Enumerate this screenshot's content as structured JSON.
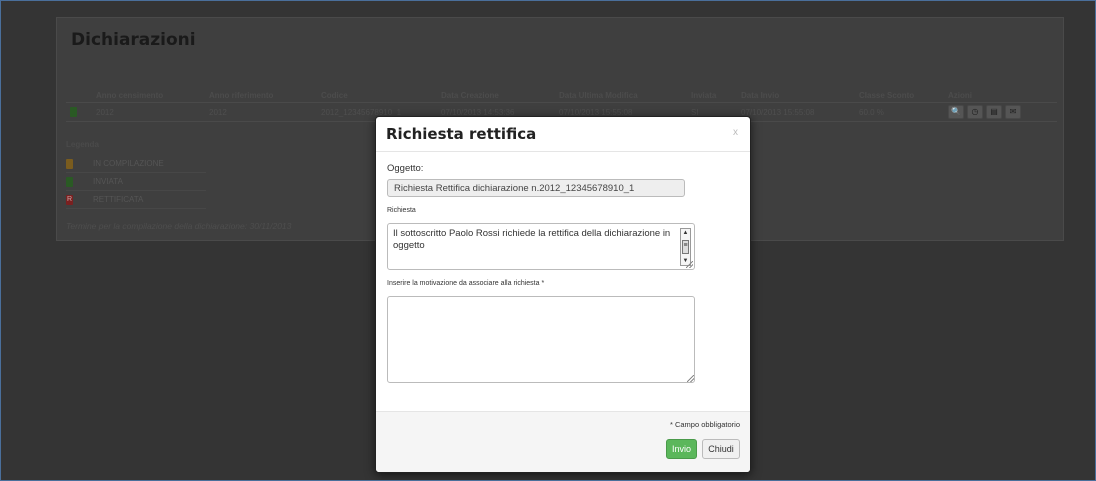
{
  "page": {
    "title": "Dichiarazioni"
  },
  "table": {
    "headers": [
      "",
      "Anno censimento",
      "Anno riferimento",
      "Codice",
      "Data Creazione",
      "Data Ultima Modifica",
      "Inviata",
      "Data Invio",
      "Classe Sconto",
      "Azioni"
    ],
    "row": {
      "status": "green",
      "anno_censimento": "2012",
      "anno_riferimento": "2012",
      "codice": "2012_12345678910_1",
      "data_creazione": "07/10/2013 14:53:36",
      "data_ultima_modifica": "07/10/2013 15:55:08",
      "inviata": "SI",
      "data_invio": "07/10/2013 15:55:08",
      "classe_sconto": "60.0 %"
    },
    "actions": [
      {
        "name": "search-icon",
        "glyph": "🔍"
      },
      {
        "name": "clock-icon",
        "glyph": "◷"
      },
      {
        "name": "document-icon",
        "glyph": "▤"
      },
      {
        "name": "envelope-icon",
        "glyph": "✉"
      }
    ]
  },
  "legend": {
    "title": "Legenda",
    "items": [
      {
        "color": "orange",
        "mark": "",
        "label": "IN COMPILAZIONE"
      },
      {
        "color": "green",
        "mark": "",
        "label": "INVIATA"
      },
      {
        "color": "red",
        "mark": "R",
        "label": "RETTIFICATA"
      }
    ]
  },
  "deadline_note": "Termine per la compilazione della dichiarazione: 30/11/2013",
  "modal": {
    "title": "Richiesta rettifica",
    "close_label": "x",
    "oggetto_label": "Oggetto:",
    "oggetto_value": "Richiesta Rettifica dichiarazione n.2012_12345678910_1",
    "richiesta_label": "Richiesta",
    "richiesta_text": "Il sottoscritto Paolo Rossi richiede la rettifica della dichiarazione in oggetto",
    "motivazione_label": "Inserire la motivazione da associare alla richiesta *",
    "motivazione_value": "",
    "required_note": "* Campo obbligatorio",
    "send_label": "Invio",
    "close_button_label": "Chiudi"
  },
  "colors": {
    "send_button": "#5bb75b",
    "window_border": "#4a6f9b"
  }
}
